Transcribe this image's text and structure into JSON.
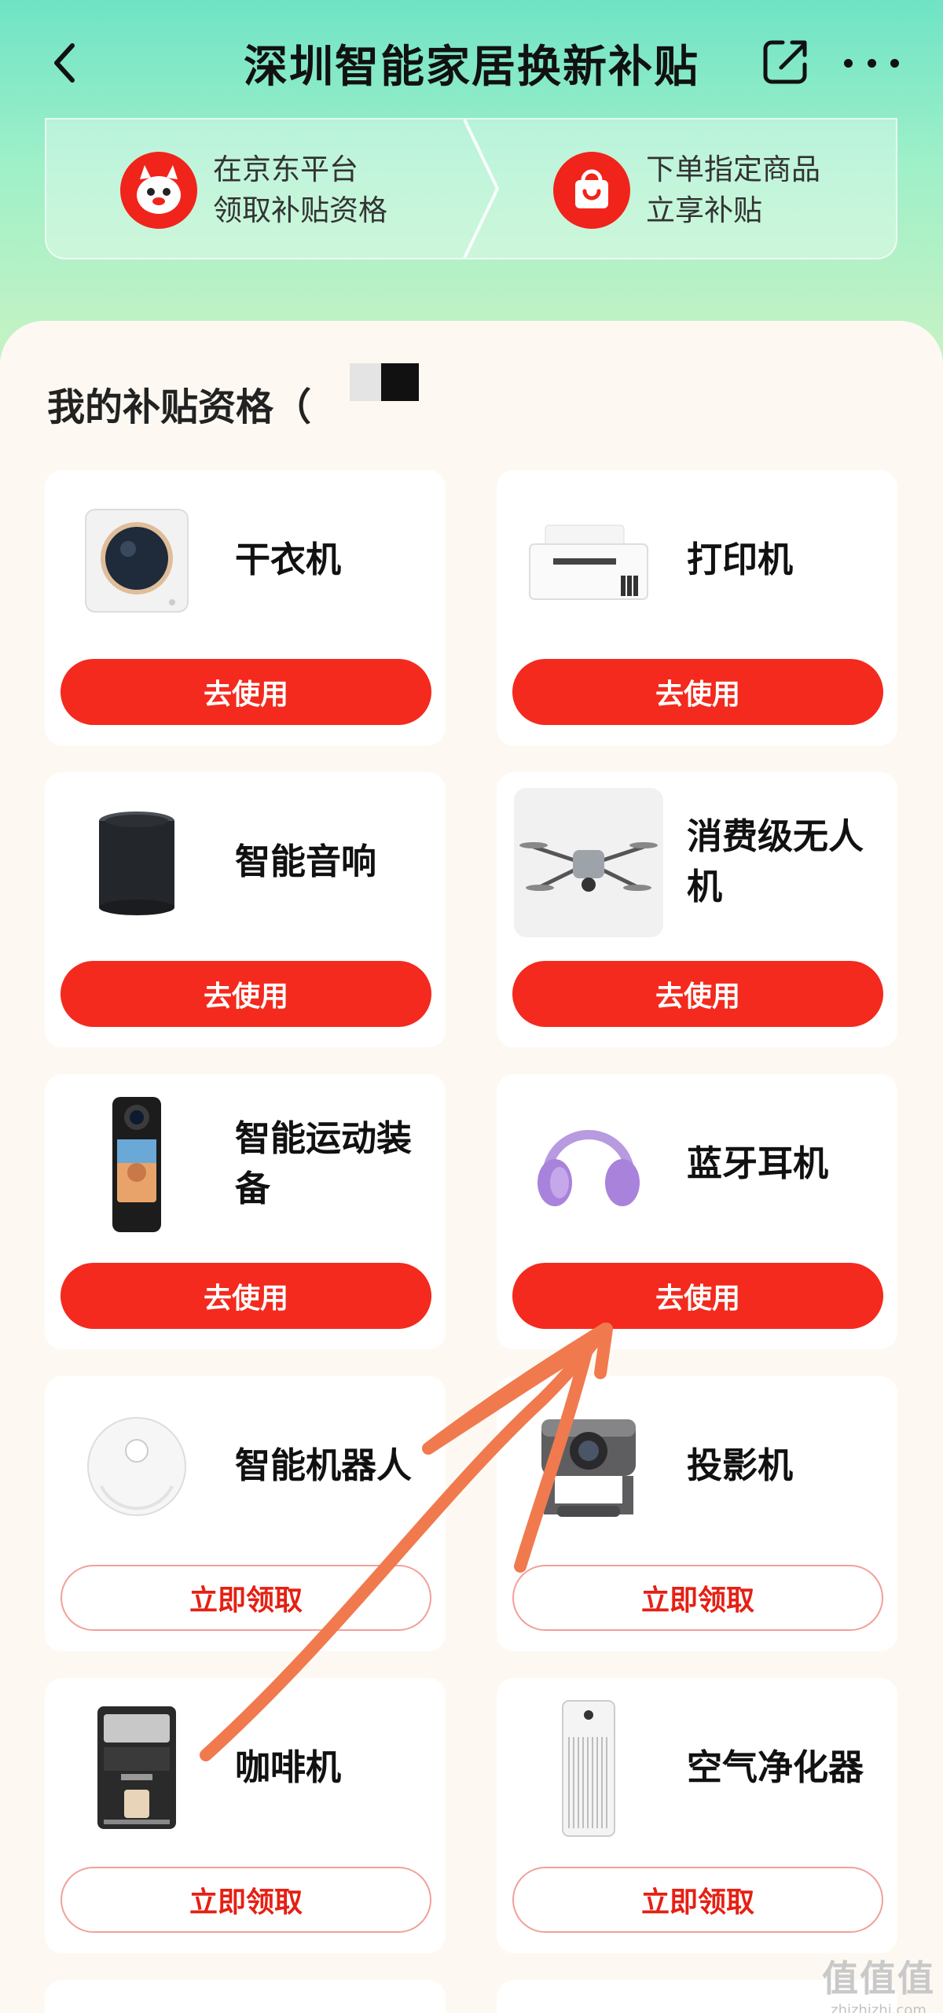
{
  "header": {
    "title": "深圳智能家居换新补贴"
  },
  "steps": [
    {
      "line1": "在京东平台",
      "line2": "领取补贴资格"
    },
    {
      "line1": "下单指定商品",
      "line2": "立享补贴"
    }
  ],
  "section": {
    "title": "我的补贴资格（"
  },
  "cards": [
    {
      "name": "干衣机",
      "button": "去使用",
      "icon": "dryer-image"
    },
    {
      "name": "打印机",
      "button": "去使用",
      "icon": "printer-image"
    },
    {
      "name": "智能音响",
      "button": "去使用",
      "icon": "smart-speaker-image"
    },
    {
      "name": "消费级无人机",
      "button": "去使用",
      "icon": "drone-image"
    },
    {
      "name": "智能运动装备",
      "button": "去使用",
      "icon": "action-camera-image"
    },
    {
      "name": "蓝牙耳机",
      "button": "去使用",
      "icon": "headphones-image"
    },
    {
      "name": "智能机器人",
      "button": "立即领取",
      "icon": "robot-vacuum-image"
    },
    {
      "name": "投影机",
      "button": "立即领取",
      "icon": "projector-image"
    },
    {
      "name": "咖啡机",
      "button": "立即领取",
      "icon": "coffee-machine-image"
    },
    {
      "name": "空气净化器",
      "button": "立即领取",
      "icon": "air-purifier-image"
    }
  ],
  "watermark": {
    "logo": "值值值",
    "url": "zhizhizhi.com"
  },
  "colors": {
    "primary_red": "#f32a1d",
    "annotation_orange": "#f07a4e",
    "header_gradient_top": "#6fe3c6",
    "background": "#fdf9f2"
  }
}
